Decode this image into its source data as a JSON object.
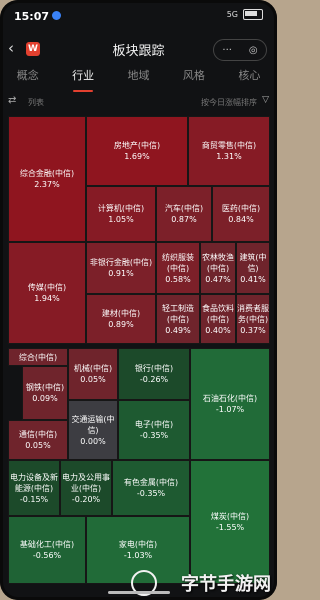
{
  "status": {
    "time": "15:07",
    "network": "5G"
  },
  "header": {
    "title": "板块跟踪",
    "logo": "W",
    "menu": "···",
    "close": "◎"
  },
  "tabs": [
    "概念",
    "行业",
    "地域",
    "风格",
    "核心"
  ],
  "active_tab": 1,
  "toolbar": {
    "list_label": "列表",
    "sort_label": "按今日涨幅排序"
  },
  "tiles": [
    {
      "name": "综合金融(中信)",
      "value": "2.37%"
    },
    {
      "name": "房地产(中信)",
      "value": "1.69%"
    },
    {
      "name": "商贸零售(中信)",
      "value": "1.31%"
    },
    {
      "name": "计算机(中信)",
      "value": "1.05%"
    },
    {
      "name": "汽车(中信)",
      "value": "0.87%"
    },
    {
      "name": "医药(中信)",
      "value": "0.84%"
    },
    {
      "name": "传媒(中信)",
      "value": "1.94%"
    },
    {
      "name": "非银行金融(中信)",
      "value": "0.91%"
    },
    {
      "name": "纺织服装(中信)",
      "value": "0.58%"
    },
    {
      "name": "农林牧渔(中信)",
      "value": "0.47%"
    },
    {
      "name": "建筑(中信)",
      "value": "0.41%"
    },
    {
      "name": "建材(中信)",
      "value": "0.89%"
    },
    {
      "name": "轻工制造(中信)",
      "value": "0.49%"
    },
    {
      "name": "食品饮料(中信)",
      "value": "0.40%"
    },
    {
      "name": "消费者服务(中信)",
      "value": "0.37%"
    },
    {
      "name": "综合(中信)",
      "value": ""
    },
    {
      "name": "钢铁(中信)",
      "value": "0.09%"
    },
    {
      "name": "机械(中信)",
      "value": "0.05%"
    },
    {
      "name": "通信(中信)",
      "value": "0.05%"
    },
    {
      "name": "交通运输(中信)",
      "value": "0.00%"
    },
    {
      "name": "银行(中信)",
      "value": "-0.26%"
    },
    {
      "name": "电子(中信)",
      "value": "-0.35%"
    },
    {
      "name": "石油石化(中信)",
      "value": "-1.07%"
    },
    {
      "name": "电力设备及新能源(中信)",
      "value": "-0.15%"
    },
    {
      "name": "电力及公用事业(中信)",
      "value": "-0.20%"
    },
    {
      "name": "有色金属(中信)",
      "value": "-0.35%"
    },
    {
      "name": "煤炭(中信)",
      "value": "-1.55%"
    },
    {
      "name": "基础化工(中信)",
      "value": "-0.56%"
    },
    {
      "name": "家电(中信)",
      "value": "-1.03%"
    }
  ],
  "watermark": "字节手游网"
}
